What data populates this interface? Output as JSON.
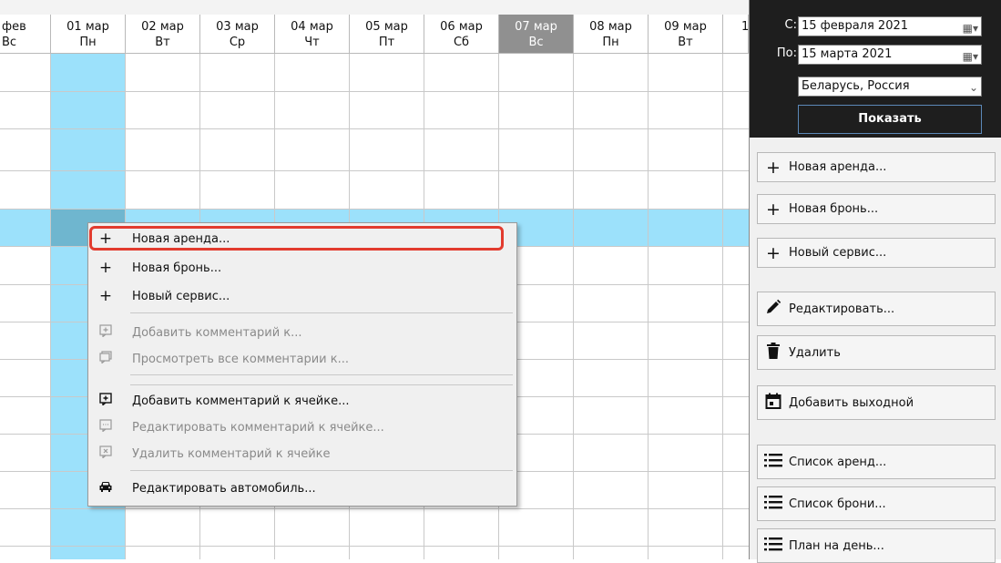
{
  "grid": {
    "headers": [
      {
        "date": "фев",
        "day": "Вс"
      },
      {
        "date": "01 мар",
        "day": "Пн"
      },
      {
        "date": "02 мар",
        "day": "Вт"
      },
      {
        "date": "03 мар",
        "day": "Ср"
      },
      {
        "date": "04 мар",
        "day": "Чт"
      },
      {
        "date": "05 мар",
        "day": "Пт"
      },
      {
        "date": "06 мар",
        "day": "Сб"
      },
      {
        "date": "07 мар",
        "day": "Вс"
      },
      {
        "date": "08 мар",
        "day": "Пн"
      },
      {
        "date": "09 мар",
        "day": "Вт"
      },
      {
        "date": "1",
        "day": ""
      }
    ]
  },
  "context_menu": {
    "items": [
      {
        "icon": "plus-icon",
        "label": "Новая аренда...",
        "enabled": true
      },
      {
        "icon": "plus-icon",
        "label": "Новая бронь...",
        "enabled": true
      },
      {
        "icon": "plus-icon",
        "label": "Новый сервис...",
        "enabled": true
      },
      {
        "icon": "add-comment-icon",
        "label": "Добавить комментарий к...",
        "enabled": false
      },
      {
        "icon": "view-comments-icon",
        "label": "Просмотреть все комментарии к...",
        "enabled": false
      },
      {
        "icon": "add-cell-comment-icon",
        "label": "Добавить комментарий к ячейке...",
        "enabled": true
      },
      {
        "icon": "edit-cell-comment-icon",
        "label": "Редактировать комментарий к ячейке...",
        "enabled": false
      },
      {
        "icon": "delete-cell-comment-icon",
        "label": "Удалить комментарий к ячейке",
        "enabled": false
      },
      {
        "icon": "car-icon",
        "label": "Редактировать автомобиль...",
        "enabled": true
      }
    ]
  },
  "filter": {
    "from_label": "С:",
    "from_value": "15 февраля  2021",
    "to_label": "По:",
    "to_value": "15  марта  2021",
    "region_value": "Беларусь, Россия",
    "show_label": "Показать"
  },
  "actions": [
    {
      "icon": "plus-icon",
      "label": "Новая аренда..."
    },
    {
      "icon": "plus-icon",
      "label": "Новая бронь..."
    },
    {
      "icon": "plus-icon",
      "label": "Новый сервис..."
    },
    {
      "icon": "pencil-icon",
      "label": "Редактировать..."
    },
    {
      "icon": "trash-icon",
      "label": "Удалить"
    },
    {
      "icon": "calendar-day-icon",
      "label": "Добавить выходной"
    },
    {
      "icon": "list-icon",
      "label": "Список аренд..."
    },
    {
      "icon": "list-icon",
      "label": "Список брони..."
    },
    {
      "icon": "list-icon",
      "label": "План на день..."
    }
  ]
}
